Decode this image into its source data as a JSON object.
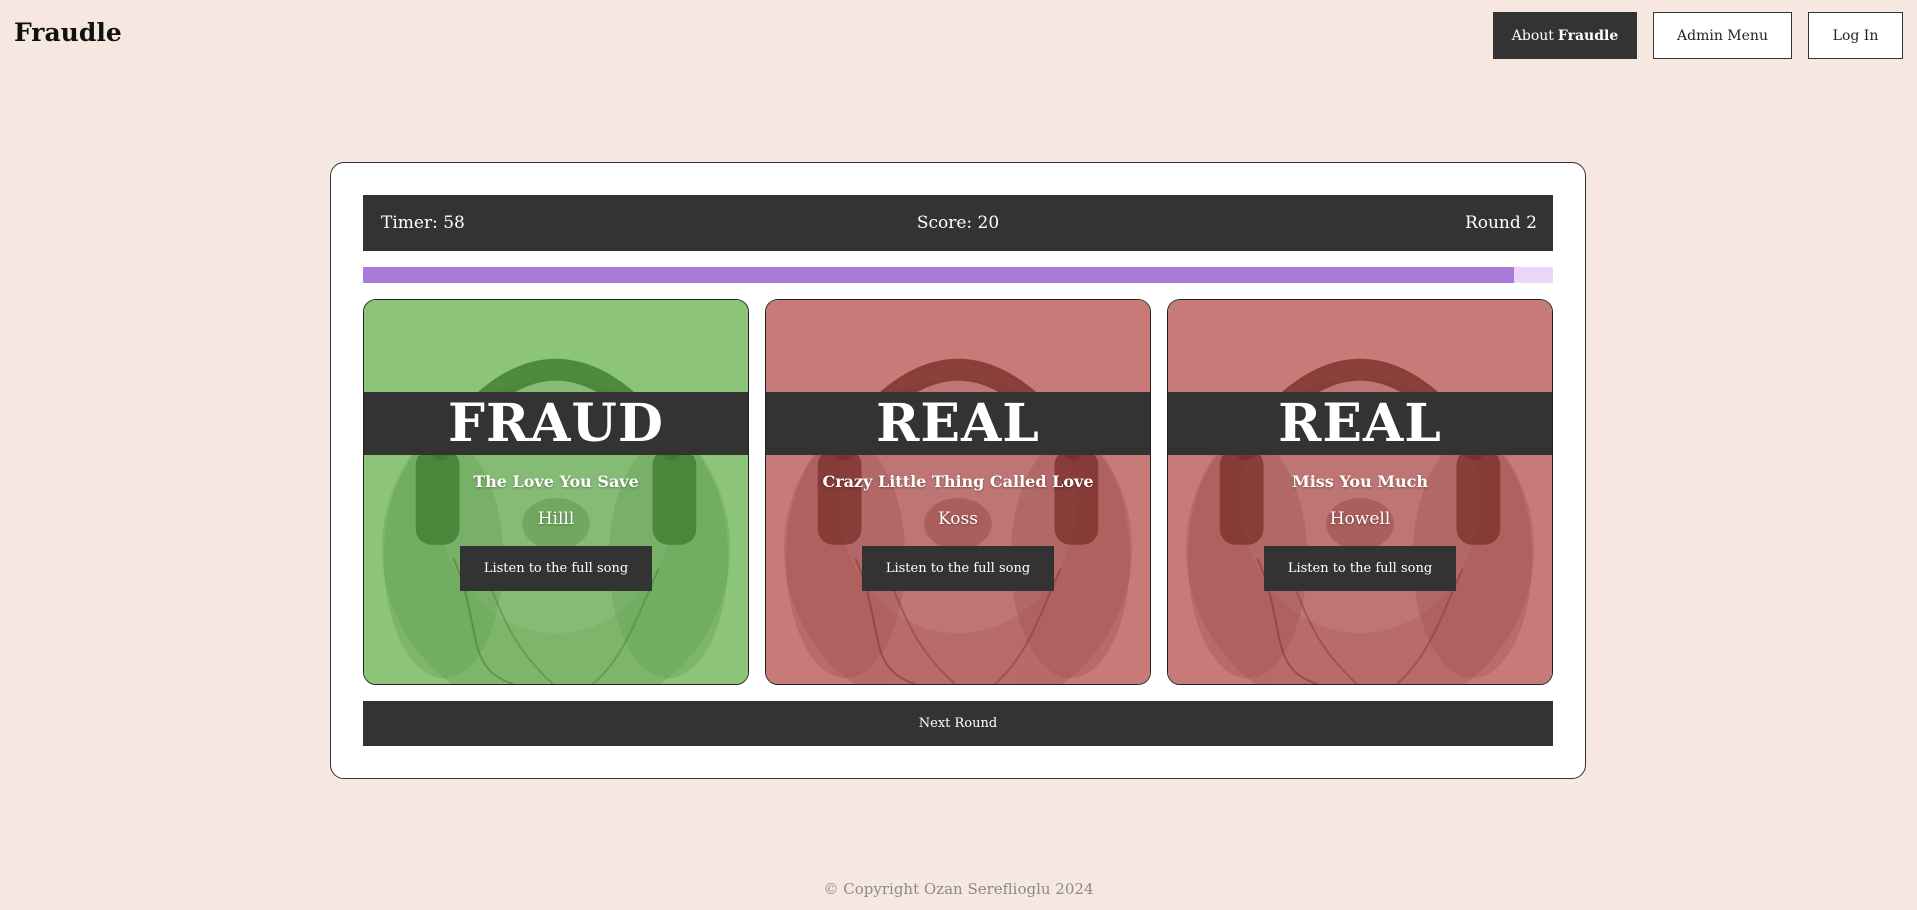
{
  "header": {
    "brand": "Fraudle",
    "nav": {
      "about_prefix": "About",
      "about_emphasis": "Fraudle",
      "admin": "Admin Menu",
      "login": "Log In"
    }
  },
  "game": {
    "timer": "Timer: 58",
    "score": "Score: 20",
    "round": "Round 2",
    "progress_fraction": 0.967,
    "colors": {
      "progress_fill": "#a97ad8",
      "progress_track": "#ead6f7",
      "fraud_tint": "#8cc47a",
      "real_tint": "#c77a78",
      "panel_dark": "#333333"
    },
    "cards": [
      {
        "verdict": "FRAUD",
        "title": "The Love You Save",
        "artist": "Hilll",
        "button": "Listen to the full song",
        "tint": "fraud",
        "image_icon": "dog-with-headphones-icon"
      },
      {
        "verdict": "REAL",
        "title": "Crazy Little Thing Called Love",
        "artist": "Koss",
        "button": "Listen to the full song",
        "tint": "real",
        "image_icon": "dog-with-headphones-icon"
      },
      {
        "verdict": "REAL",
        "title": "Miss You Much",
        "artist": "Howell",
        "button": "Listen to the full song",
        "tint": "real",
        "image_icon": "dog-with-headphones-icon"
      }
    ],
    "next_button": "Next Round"
  },
  "footer": {
    "copyright": "© Copyright Ozan Sereflioglu 2024"
  }
}
